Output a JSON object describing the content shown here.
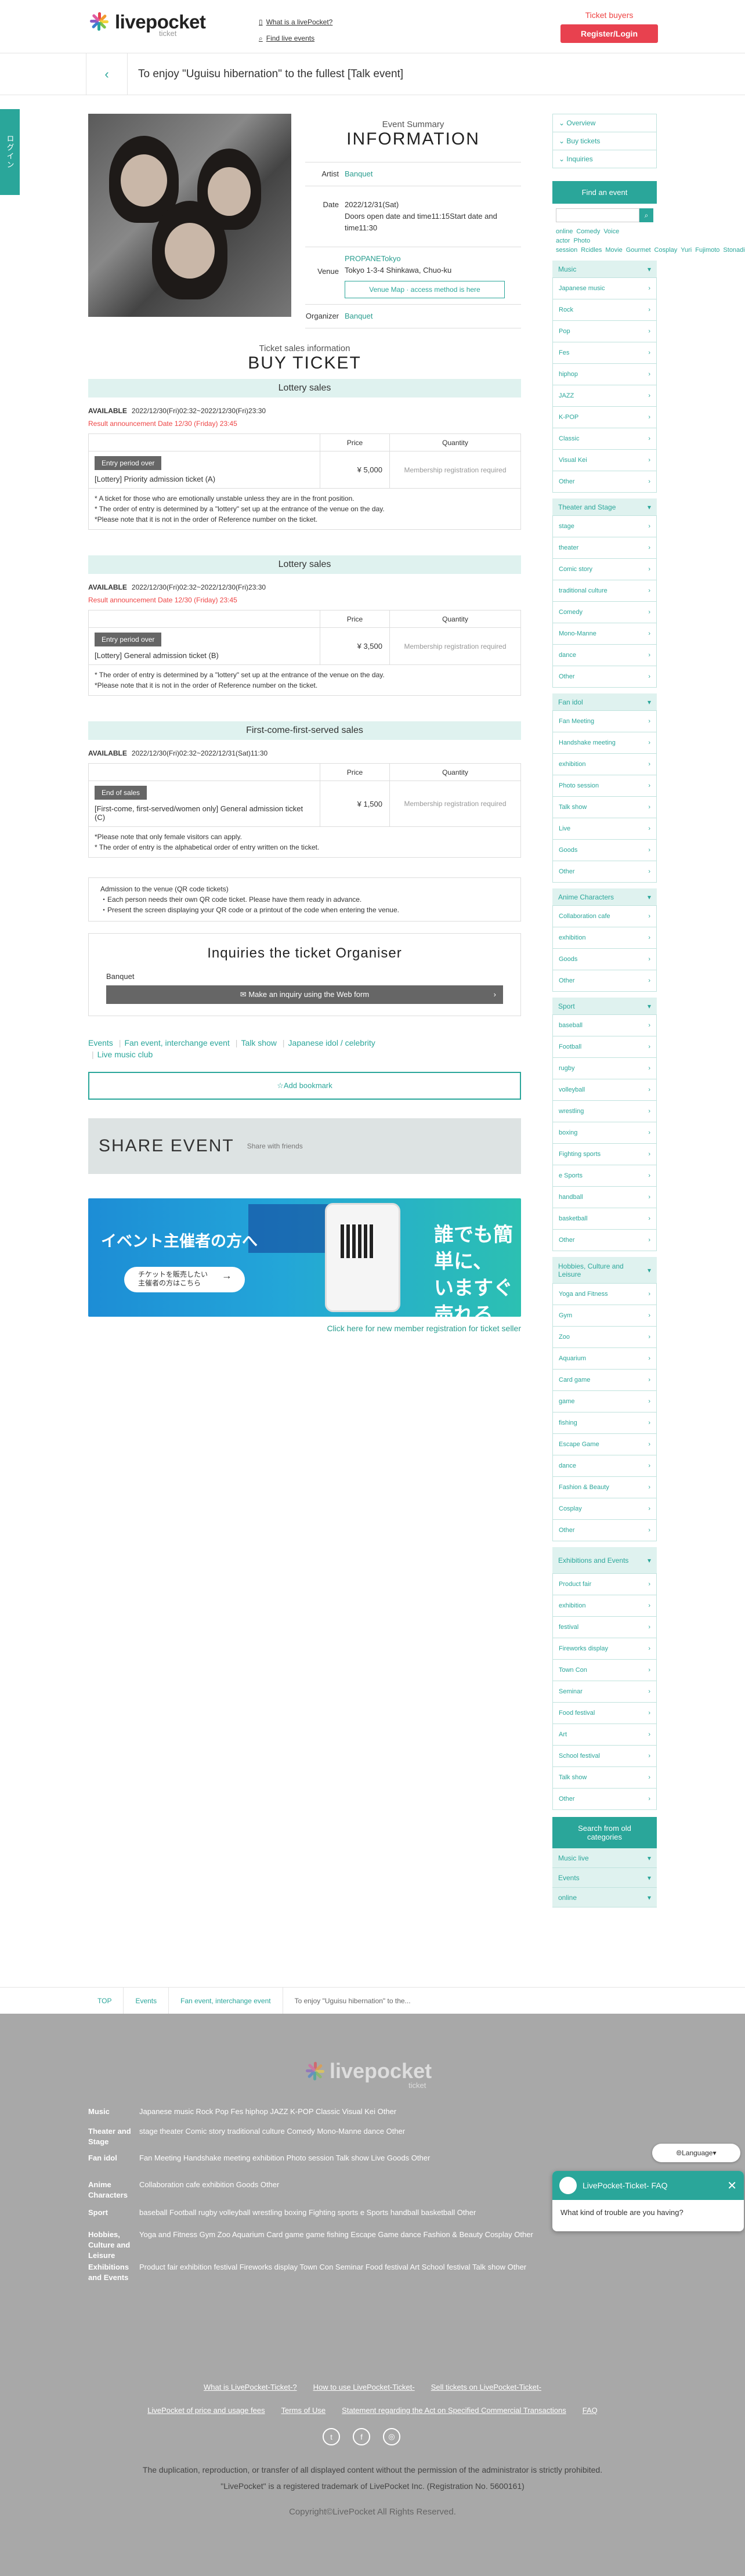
{
  "header": {
    "logo": "livepocket",
    "logo_sub": "ticket",
    "what_is": "What is a livePocket?",
    "find_live": "Find live events",
    "ticket_buyers": "Ticket buyers",
    "register": "Register/Login"
  },
  "login_tab": "ログイン",
  "title": "To enjoy \"Uguisu hibernation\" to the fullest [Talk event]",
  "summary": {
    "sub": "Event Summary",
    "title": "INFORMATION",
    "artist_k": "Artist",
    "artist_v": "Banquet",
    "date_k": "Date",
    "date_v1": "2022/12/31(Sat)",
    "date_v2": "Doors open date and time11:15Start date and time11:30",
    "venue_k": "Venue",
    "venue_name": "PROPANETokyo",
    "venue_addr": "Tokyo 1-3-4 Shinkawa, Chuo-ku",
    "venue_btn": "Venue Map · access method is here",
    "organizer_k": "Organizer",
    "organizer_v": "Banquet"
  },
  "buy": {
    "sub": "Ticket sales information",
    "title": "BUY TICKET",
    "price_h": "Price",
    "qty_h": "Quantity",
    "member_req": "Membership registration required",
    "available": "AVAILABLE",
    "sections": [
      {
        "band": "Lottery sales",
        "period": "2022/12/30(Fri)02:32~2022/12/30(Fri)23:30",
        "result": "Result announcement Date 12/30 (Friday) 23:45",
        "badge": "Entry period over",
        "name": "[Lottery] Priority admission ticket (A)",
        "price": "¥ 5,000",
        "notes": [
          "* A ticket for those who are emotionally unstable unless they are in the front position.",
          "* The order of entry is determined by a \"lottery\" set up at the entrance of the venue on the day.",
          "*Please note that it is not in the order of Reference number on the ticket."
        ]
      },
      {
        "band": "Lottery sales",
        "period": "2022/12/30(Fri)02:32~2022/12/30(Fri)23:30",
        "result": "Result announcement Date 12/30 (Friday) 23:45",
        "badge": "Entry period over",
        "name": "[Lottery] General admission ticket (B)",
        "price": "¥ 3,500",
        "notes": [
          "* The order of entry is determined by a \"lottery\" set up at the entrance of the venue on the day.",
          "*Please note that it is not in the order of Reference number on the ticket."
        ]
      },
      {
        "band": "First-come-first-served sales",
        "period": "2022/12/30(Fri)02:32~2022/12/31(Sat)11:30",
        "result": "",
        "badge": "End of sales",
        "name": "[First-come, first-served/women only] General admission ticket (C)",
        "price": "¥ 1,500",
        "notes": [
          "*Please note that only female visitors can apply.",
          "* The order of entry is the alphabetical order of entry written on the ticket."
        ]
      }
    ]
  },
  "qr": [
    "Admission to the venue (QR code tickets)",
    "・Each person needs their own QR code ticket. Please have them ready in advance.",
    "・Present the screen displaying your QR code or a printout of the code when entering the venue."
  ],
  "inquiry": {
    "title": "Inquiries the ticket Organiser",
    "org": "Banquet",
    "btn": "Make an inquiry using the Web form"
  },
  "tags": [
    "Events",
    "Fan event, interchange event",
    "Talk show",
    "Japanese idol / celebrity",
    "Live music club"
  ],
  "bookmark": "☆Add bookmark",
  "share": {
    "title": "SHARE EVENT",
    "sub": "Share with friends"
  },
  "banner": {
    "l1": "イベント主催者の方へ",
    "pill1": "チケットを販売したい",
    "pill2": "主催者の方はこちら",
    "r1": "誰でも簡単に、",
    "r2": "いますぐ売れる"
  },
  "new_member": "Click here for new member registration for ticket seller",
  "sidebar": {
    "quick": [
      "Overview",
      "Buy tickets",
      "Inquiries"
    ],
    "find": "Find an event",
    "keywords": [
      "online",
      "Comedy",
      "Voice actor",
      "Photo session",
      "Rcidles",
      "Movie",
      "Gourmet",
      "Cosplay",
      "Yuri",
      "Fujimoto",
      "Stonadie"
    ],
    "cats": [
      {
        "h": "Music",
        "items": [
          "Japanese music",
          "Rock",
          "Pop",
          "Fes",
          "hiphop",
          "JAZZ",
          "K-POP",
          "Classic",
          "Visual Kei",
          "Other"
        ]
      },
      {
        "h": "Theater and Stage",
        "items": [
          "stage",
          "theater",
          "Comic story",
          "traditional culture",
          "Comedy",
          "Mono-Manne",
          "dance",
          "Other"
        ]
      },
      {
        "h": "Fan idol",
        "items": [
          "Fan Meeting",
          "Handshake meeting",
          "exhibition",
          "Photo session",
          "Talk show",
          "Live",
          "Goods",
          "Other"
        ]
      },
      {
        "h": "Anime Characters",
        "items": [
          "Collaboration cafe",
          "exhibition",
          "Goods",
          "Other"
        ]
      },
      {
        "h": "Sport",
        "items": [
          "baseball",
          "Football",
          "rugby",
          "volleyball",
          "wrestling",
          "boxing",
          "Fighting sports",
          "e Sports",
          "handball",
          "basketball",
          "Other"
        ]
      },
      {
        "h": "Hobbies, Culture and Leisure",
        "items": [
          "Yoga and Fitness",
          "Gym",
          "Zoo",
          "Aquarium",
          "Card game",
          "game",
          "fishing",
          "Escape Game",
          "dance",
          "Fashion & Beauty",
          "Cosplay",
          "Other"
        ]
      },
      {
        "h": "Exhibitions and Events",
        "items": [
          "Product fair",
          "exhibition",
          "festival",
          "Fireworks display",
          "Town Con",
          "Seminar",
          "Food festival",
          "Art",
          "School festival",
          "Talk show",
          "Other"
        ]
      }
    ],
    "old": "Search from old categories",
    "foot": [
      "Music live",
      "Events",
      "online"
    ]
  },
  "breadcrumb": [
    "TOP",
    "Events",
    "Fan event, interchange event",
    "To enjoy \"Uguisu hibernation\" to the..."
  ],
  "footer": {
    "logo": "livepocket",
    "logo_sub": "ticket",
    "rows": [
      {
        "k": "Music",
        "v": "Japanese music  Rock  Pop  Fes  hiphop  JAZZ  K-POP  Classic  Visual Kei  Other"
      },
      {
        "k": "Theater and Stage",
        "v": "stage  theater  Comic story  traditional culture  Comedy  Mono-Manne  dance  Other"
      },
      {
        "k": "Fan idol",
        "v": "Fan Meeting  Handshake meeting  exhibition  Photo session  Talk show  Live  Goods  Other"
      },
      {
        "k": "Anime Characters",
        "v": "Collaboration cafe  exhibition  Goods  Other"
      },
      {
        "k": "Sport",
        "v": "baseball  Football  rugby  volleyball  wrestling  boxing  Fighting sports  e Sports  handball  basketball  Other"
      },
      {
        "k": "Hobbies, Culture and Leisure",
        "v": "Yoga and Fitness  Gym  Zoo  Aquarium  Card game  game  fishing  Escape Game  dance  Fashion & Beauty  Cosplay  Other"
      },
      {
        "k": "Exhibitions and Events",
        "v": "Product fair  exhibition  festival  Fireworks display  Town Con  Seminar  Food festival  Art  School festival  Talk show  Other"
      }
    ],
    "links1": [
      "What is LivePocket-Ticket-?",
      "How to use LivePocket-Ticket-",
      "Sell tickets on LivePocket-Ticket-"
    ],
    "links2": [
      "LivePocket of price and usage fees",
      "Terms of Use",
      "Statement regarding the Act on Specified Commercial Transactions",
      "FAQ"
    ],
    "note1": "The duplication, reproduction, or transfer of all displayed content without the permission of the administrator is strictly prohibited.",
    "note2": "\"LivePocket\" is a registered trademark of LivePocket Inc. (Registration No. 5600161)",
    "copy": "Copyright©LivePocket All Rights Reserved."
  },
  "chat": {
    "lang": "Language",
    "title": "LivePocket-Ticket- FAQ",
    "msg": "What kind of trouble are you having?"
  }
}
